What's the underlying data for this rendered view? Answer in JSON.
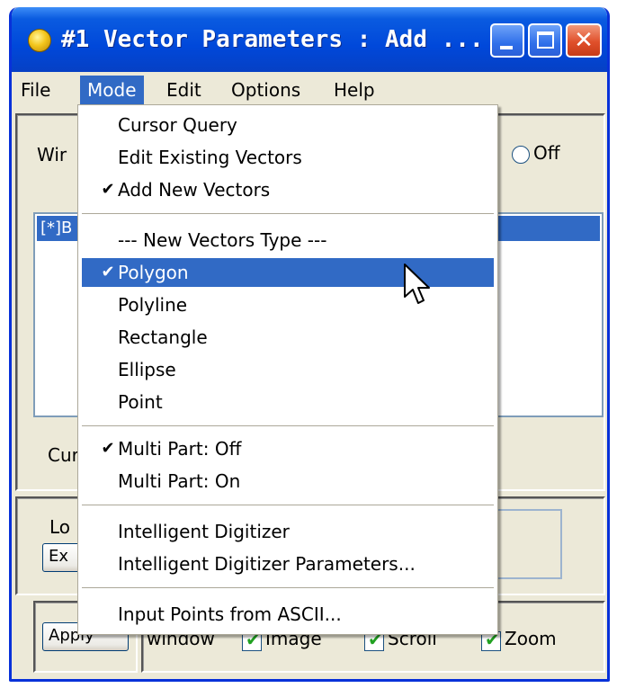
{
  "window": {
    "title": "#1 Vector Parameters : Add ...",
    "colors": {
      "titlebar": "#0A5BE0",
      "menu_highlight": "#316AC5",
      "face": "#ECE9D8",
      "close": "#E0502B"
    }
  },
  "menubar": {
    "items": [
      {
        "label": "File"
      },
      {
        "label": "Mode"
      },
      {
        "label": "Edit"
      },
      {
        "label": "Options"
      },
      {
        "label": "Help"
      }
    ],
    "open_menu": "Mode"
  },
  "background": {
    "window_label_partial": "Wir",
    "off_label": "Off",
    "list_item_partial": "[*]B",
    "current_label_partial": "Cur",
    "lo_label_partial": "Lo",
    "ex_button_partial": "Ex",
    "apply_button_partial": "Apply",
    "bottom_row": {
      "window_label_partial": "window",
      "checkboxes": [
        {
          "label": "Image",
          "checked": true
        },
        {
          "label": "Scroll",
          "checked": true
        },
        {
          "label": "Zoom",
          "checked": true
        }
      ]
    }
  },
  "mode_menu": {
    "group1": [
      {
        "label": "Cursor Query",
        "checked": false
      },
      {
        "label": "Edit Existing Vectors",
        "checked": false
      },
      {
        "label": "Add New Vectors",
        "checked": true
      }
    ],
    "type_header": "--- New Vectors Type ---",
    "group2": [
      {
        "label": "Polygon",
        "checked": true,
        "highlighted": true
      },
      {
        "label": "Polyline",
        "checked": false
      },
      {
        "label": "Rectangle",
        "checked": false
      },
      {
        "label": "Ellipse",
        "checked": false
      },
      {
        "label": "Point",
        "checked": false
      }
    ],
    "group3": [
      {
        "label": "Multi Part: Off",
        "checked": true
      },
      {
        "label": "Multi Part: On",
        "checked": false
      }
    ],
    "group4": [
      {
        "label": "Intelligent Digitizer",
        "checked": false
      },
      {
        "label": "Intelligent Digitizer Parameters...",
        "checked": false
      }
    ],
    "group5": [
      {
        "label": "Input Points from ASCII...",
        "checked": false
      }
    ],
    "check_glyph": "✔"
  }
}
